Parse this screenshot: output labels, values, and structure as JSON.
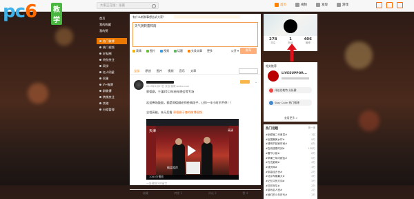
{
  "brand": {
    "logo_pc": "pc",
    "logo_six": "6",
    "logo_badge": "教学"
  },
  "topbar": {
    "search_placeholder": "大家正在搜：张嘉",
    "nav": [
      {
        "label": "首页",
        "active": true
      },
      {
        "label": "视频",
        "active": false
      },
      {
        "label": "发现",
        "active": false
      },
      {
        "label": "游戏",
        "active": false
      }
    ]
  },
  "sidebar": {
    "items": [
      {
        "label": "首页",
        "highlight": false
      },
      {
        "label": "我的收藏",
        "highlight": false
      },
      {
        "label": "我的赞",
        "highlight": false
      },
      {
        "label": "热门微博",
        "highlight": true
      },
      {
        "label": "热门视频",
        "highlight": false
      },
      {
        "label": "好友圈",
        "highlight": false
      },
      {
        "label": "特别关注",
        "highlight": false
      },
      {
        "label": "同学",
        "highlight": false
      },
      {
        "label": "名人明星",
        "highlight": false
      },
      {
        "label": "同事",
        "highlight": false
      },
      {
        "label": "V+微博",
        "highlight": false
      },
      {
        "label": "群微博",
        "highlight": false
      },
      {
        "label": "悄悄关注",
        "highlight": false
      },
      {
        "label": "其他",
        "highlight": false
      },
      {
        "label": "分组管理",
        "highlight": false
      }
    ]
  },
  "publisher": {
    "prompt": "有什么新鲜事想告诉大家？",
    "text": "天气阴转雷阵雨",
    "tools": [
      "表情",
      "图片",
      "视频",
      "话题",
      "头条文章",
      "更多"
    ],
    "visibility": "公开",
    "submit": "发布"
  },
  "feed_tabs": [
    "全部",
    "原创",
    "图片",
    "视频",
    "音乐",
    "文章"
  ],
  "post": {
    "time": "2019年4月27日 来自 微博 weibo.com",
    "line1": "郭德纲，于谦2013年新年晚会等专场",
    "line2": "欢迎捧场鼓励，都是郭德纲老师经典段子，让你一辛小时乐不停！！",
    "line3": "全程高能，先马后看",
    "link": "郭德纲于谦的微博视频",
    "video_tv": "天津",
    "video_corner": "高清",
    "video_sub": "搞笑相声",
    "video_duration": "1080万播放",
    "below_link": "一条视频下的留言",
    "actions": [
      "收藏",
      "转发 1",
      "评论 2",
      "赞 4"
    ]
  },
  "profile": {
    "stats": [
      {
        "n": "278",
        "l": "关注"
      },
      {
        "n": "1",
        "l": "粉丝"
      },
      {
        "n": "406",
        "l": "微博"
      }
    ]
  },
  "card2": {
    "header": "相关推荐",
    "name": "LIVESUPPOR...",
    "rows": [
      "伟伯伦勒特 分析鬃",
      "Stay Calm 热门微博"
    ],
    "more": "查看更多 >"
  },
  "hot": {
    "header": "热门话题",
    "refresh": "换一换",
    "items": [
      {
        "t": "#余额宝二代首发#",
        "v": "1亿"
      },
      {
        "t": "#全国最美乡村#",
        "v": "9万"
      },
      {
        "t": "#清明节回家时间#",
        "v": "8万"
      },
      {
        "t": "#告别感恩时刻#",
        "v": "158万"
      },
      {
        "t": "#春节小孩#",
        "v": "6万"
      },
      {
        "t": "#苹果三年内报告#",
        "v": "5万"
      },
      {
        "t": "#万达影城#",
        "v": "4万"
      },
      {
        "t": "#成员网#",
        "v": "3万"
      },
      {
        "t": "#张嘉佳去世#",
        "v": "2万"
      },
      {
        "t": "#北京车展最大#",
        "v": "3万"
      },
      {
        "t": "#记忆中的方向#",
        "v": "3万"
      },
      {
        "t": "#花样年华#",
        "v": "2万"
      },
      {
        "t": "#游戏名人堂#",
        "v": "2万"
      },
      {
        "t": "#我们的少年时代#",
        "v": "1万"
      }
    ]
  },
  "colors": {
    "accent": "#ff8200",
    "arrow": "#e0111a"
  }
}
